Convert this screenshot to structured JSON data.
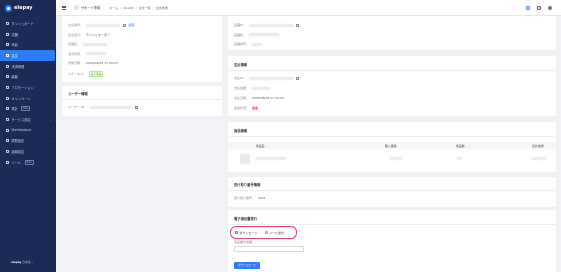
{
  "brand": {
    "name": "elepay",
    "accent": "#2e7cf6",
    "sidebar_bg": "#1b2b55"
  },
  "sidebar": {
    "items": [
      {
        "label": "ダッシュボード",
        "icon": "dashboard-icon"
      },
      {
        "label": "店舗",
        "icon": "store-icon"
      },
      {
        "label": "商品",
        "icon": "product-icon",
        "caret": "⌄"
      },
      {
        "label": "注文",
        "icon": "order-icon",
        "active": true
      },
      {
        "label": "決済管理",
        "icon": "payment-icon",
        "caret": "⌄"
      },
      {
        "label": "顧客",
        "icon": "customer-icon"
      },
      {
        "label": "プロモーション",
        "icon": "promotion-icon"
      },
      {
        "label": "キャンペーン",
        "icon": "campaign-icon"
      },
      {
        "label": "集計",
        "icon": "report-icon",
        "badge": "Beta"
      },
      {
        "label": "サービス設定",
        "icon": "service-settings-icon",
        "caret": "⌄"
      },
      {
        "label": "Marketplace",
        "icon": "marketplace-icon"
      },
      {
        "label": "開発設定",
        "icon": "developer-icon",
        "caret": "⌄"
      },
      {
        "label": "組織設定",
        "icon": "organization-icon"
      },
      {
        "label": "ツール",
        "icon": "tools-icon",
        "badge": "Beta"
      }
    ],
    "footer": {
      "brand": "elepay",
      "lang": "日本語",
      "caret": "⌄"
    }
  },
  "header": {
    "support_label": "サポート専用",
    "breadcrumbs": [
      "ホーム",
      "OneQR",
      "注文一覧",
      "注文詳細"
    ],
    "user_name": "",
    "user_email": ""
  },
  "order_info": {
    "rows": [
      {
        "label": "注文番号：",
        "value": "",
        "link": "顧客"
      },
      {
        "label": "注文区分：",
        "value": "モバイルオーダー"
      },
      {
        "label": "店舗名：",
        "value": ""
      },
      {
        "label": "決済状態：",
        "value": ""
      },
      {
        "label": "作成日時：",
        "value": "2025/08/15 17:59:25"
      },
      {
        "label": "ステータス：",
        "value": "完了済み"
      }
    ]
  },
  "user_info": {
    "title": "ユーザー情報",
    "rows": [
      {
        "label": "ユーザー ID：",
        "value": ""
      }
    ]
  },
  "top_right": {
    "rows": [
      {
        "label": "店舗ID：",
        "value": ""
      },
      {
        "label": "店舗名：",
        "value": ""
      },
      {
        "label": "店舗番号：",
        "value": ""
      }
    ]
  },
  "payment_info": {
    "title": "支払情報",
    "rows": [
      {
        "label": "支払ID：",
        "value": ""
      },
      {
        "label": "支払金額：",
        "value": ""
      },
      {
        "label": "支払日時：",
        "value": "2025/08/15 17:59:26"
      },
      {
        "label": "返金状況：",
        "value": "返金"
      }
    ]
  },
  "product_info": {
    "title": "商品情報",
    "columns": [
      "商品名",
      "購入価格",
      "商品数",
      "合計金額"
    ]
  },
  "pickup_info": {
    "title": "受け取り番号情報",
    "rows": [
      {
        "label": "受け取り番号：",
        "value": "0001"
      }
    ]
  },
  "receipt": {
    "title": "電子領収書発行",
    "options": [
      {
        "label": "ダウンロード",
        "selected": true
      },
      {
        "label": "メール送付",
        "selected": false
      }
    ],
    "field_label": "宛名書き候補",
    "button_label": "ダウンロード"
  }
}
